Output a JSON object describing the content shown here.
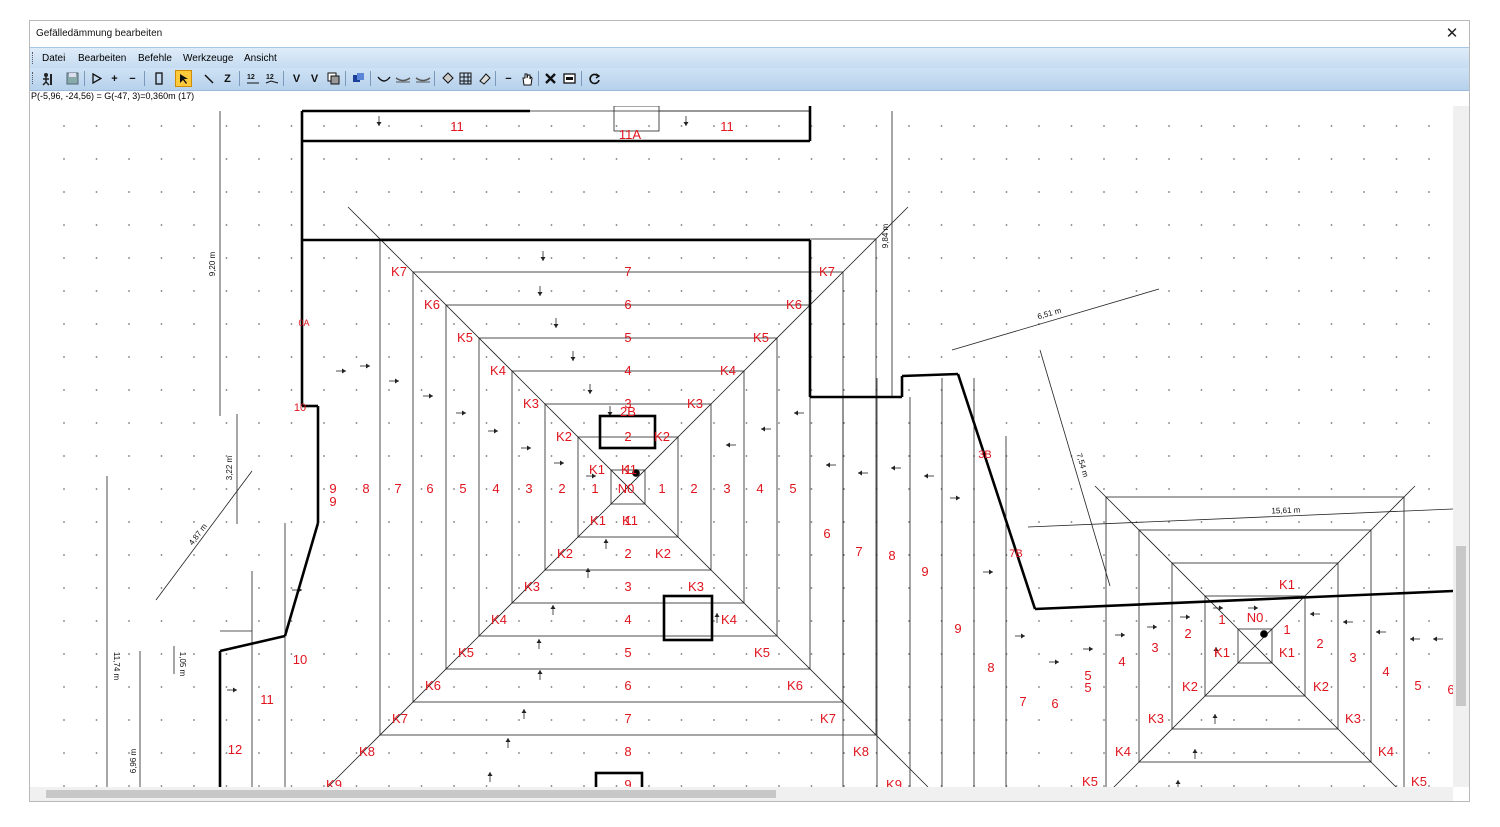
{
  "window": {
    "title": "Gefälledämmung bearbeiten",
    "close_symbol": "✕"
  },
  "menu": [
    {
      "label": "Datei"
    },
    {
      "label": "Bearbeiten"
    },
    {
      "label": "Befehle"
    },
    {
      "label": "Werkzeuge"
    },
    {
      "label": "Ansicht"
    }
  ],
  "toolbar": {
    "buttons": [
      "player-icon",
      "save-icon",
      "play-icon",
      "plus-icon",
      "minus-icon",
      "door-icon",
      "pointer-icon",
      "line-icon",
      "z-icon",
      "label-icon",
      "label2-icon",
      "v-icon",
      "v2-icon",
      "copy-icon",
      "layers-icon",
      "curve-icon",
      "wave-icon",
      "wave2-icon",
      "fill-icon",
      "grid-icon",
      "erase-icon",
      "dash-icon",
      "hand-icon",
      "delete-icon",
      "window-icon",
      "refresh-icon"
    ],
    "symbols": {
      "z": "Z",
      "plus": "+",
      "minus": "−",
      "v": "V",
      "v2": "V",
      "dash": "−"
    }
  },
  "status": {
    "text": "P(-5,96, -24,56) = G(-47, 3)=0,360m (17)"
  },
  "drawing": {
    "line_color": "#000000",
    "label_color": "#e0141e",
    "dimension_labels": [
      "9,20 m",
      "9,84 m",
      "6,51 m",
      "7,54 m",
      "15,61 m",
      "3,22 m",
      "4,87 m",
      "11,74 m",
      "1,05 m",
      "6,96 m"
    ],
    "top_labels": [
      "11",
      "11A",
      "11"
    ],
    "small_labels": [
      "0A",
      "10",
      "3B",
      "7B",
      "12"
    ],
    "ring_labels_left": [
      {
        "k": "K7",
        "n": "7"
      },
      {
        "k": "K6",
        "n": "6"
      },
      {
        "k": "K5",
        "n": "5"
      },
      {
        "k": "K4",
        "n": "4"
      },
      {
        "k": "K3",
        "n": "3"
      },
      {
        "k": "K2",
        "n": "2"
      },
      {
        "k": "K1",
        "n": "1"
      }
    ],
    "center_label": "N0",
    "center2_label": "2B",
    "row_numbers": [
      "9",
      "8",
      "7",
      "6",
      "5",
      "4",
      "3",
      "2",
      "1",
      "1",
      "2",
      "3",
      "4",
      "5"
    ],
    "right_numbers": [
      "6",
      "7",
      "8",
      "9",
      "9",
      "8",
      "7",
      "6",
      "5"
    ],
    "bottom_labels": [
      "K9",
      "K8",
      "K7",
      "K6",
      "K5",
      "K4",
      "K3",
      "K2",
      "K1",
      "10",
      "11",
      "12"
    ],
    "bottom_ring": [
      "K2",
      "K3",
      "K4",
      "K5",
      "K6",
      "K7",
      "K8",
      "K9",
      "8",
      "9"
    ],
    "right_block": {
      "labels": [
        "K1",
        "N0",
        "K1",
        "K1",
        "K2",
        "K2",
        "K3",
        "K3",
        "K4",
        "K4",
        "K5",
        "K5"
      ],
      "numbers": [
        "1",
        "1",
        "2",
        "2",
        "3",
        "3",
        "4",
        "4",
        "5",
        "5",
        "6",
        "2",
        "3",
        "4",
        "5",
        "1"
      ]
    }
  }
}
